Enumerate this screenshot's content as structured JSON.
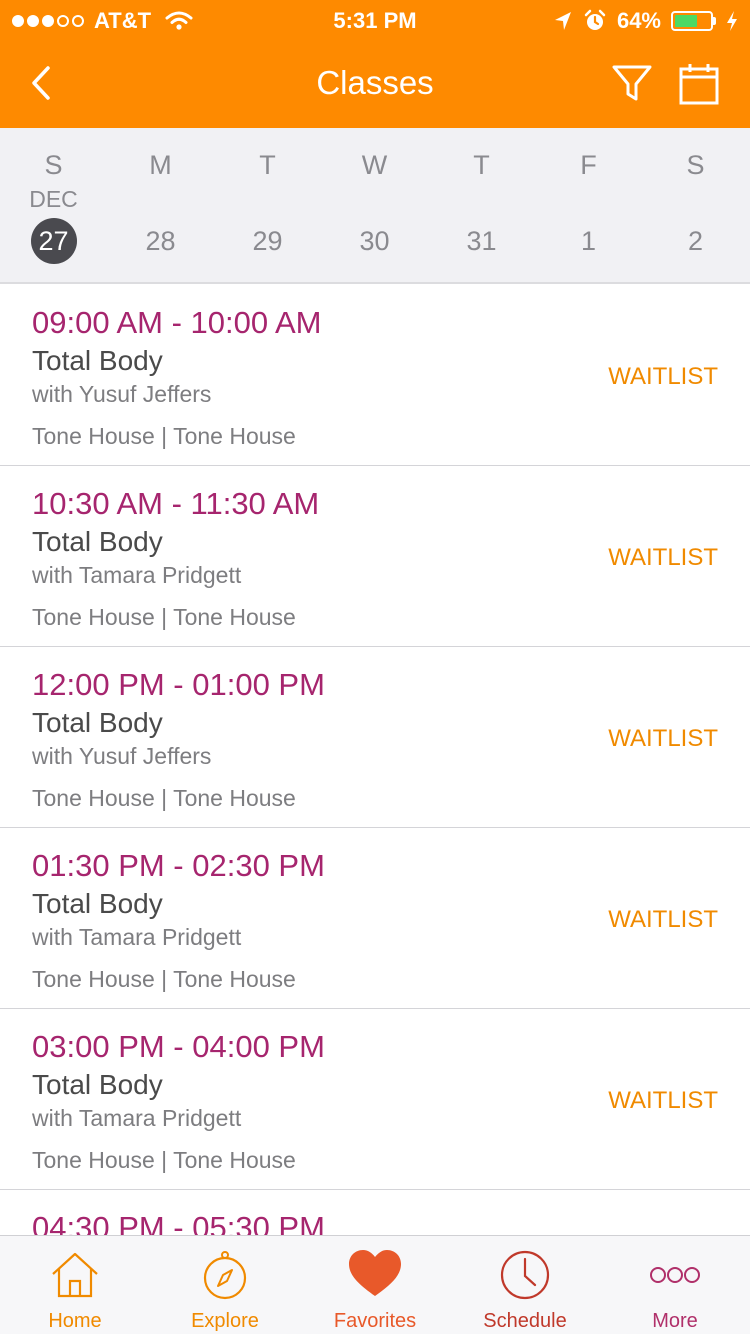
{
  "status_bar": {
    "carrier": "AT&T",
    "time": "5:31 PM",
    "battery": "64%",
    "battery_level": 0.64,
    "signal_bars_filled": 3,
    "signal_bars_total": 5
  },
  "nav": {
    "title": "Classes",
    "icons": [
      "back-icon",
      "filter-icon",
      "calendar-icon"
    ]
  },
  "colors": {
    "header_bg": "#fe8a00",
    "time_text": "#a6256e",
    "waitlist_text": "#f08a00",
    "tab_accent": "#e85a2a"
  },
  "week": {
    "month_label": "DEC",
    "days": [
      {
        "dow": "S",
        "num": "27",
        "selected": true
      },
      {
        "dow": "M",
        "num": "28",
        "selected": false
      },
      {
        "dow": "T",
        "num": "29",
        "selected": false
      },
      {
        "dow": "W",
        "num": "30",
        "selected": false
      },
      {
        "dow": "T",
        "num": "31",
        "selected": false
      },
      {
        "dow": "F",
        "num": "1",
        "selected": false
      },
      {
        "dow": "S",
        "num": "2",
        "selected": false
      }
    ]
  },
  "classes": [
    {
      "time": "09:00 AM - 10:00 AM",
      "name": "Total Body",
      "instructor": "with Yusuf Jeffers",
      "location": "Tone House | Tone House",
      "action": "WAITLIST"
    },
    {
      "time": "10:30 AM - 11:30 AM",
      "name": "Total Body",
      "instructor": "with Tamara Pridgett",
      "location": "Tone House | Tone House",
      "action": "WAITLIST"
    },
    {
      "time": "12:00 PM - 01:00 PM",
      "name": "Total Body",
      "instructor": "with Yusuf Jeffers",
      "location": "Tone House | Tone House",
      "action": "WAITLIST"
    },
    {
      "time": "01:30 PM - 02:30 PM",
      "name": "Total Body",
      "instructor": "with Tamara Pridgett",
      "location": "Tone House | Tone House",
      "action": "WAITLIST"
    },
    {
      "time": "03:00 PM - 04:00 PM",
      "name": "Total Body",
      "instructor": "with Tamara Pridgett",
      "location": "Tone House | Tone House",
      "action": "WAITLIST"
    },
    {
      "time": "04:30 PM - 05:30 PM",
      "name": "",
      "instructor": "",
      "location": "",
      "action": ""
    }
  ],
  "tabs": [
    {
      "label": "Home",
      "icon": "home-icon"
    },
    {
      "label": "Explore",
      "icon": "compass-icon"
    },
    {
      "label": "Favorites",
      "icon": "heart-icon"
    },
    {
      "label": "Schedule",
      "icon": "clock-icon"
    },
    {
      "label": "More",
      "icon": "more-icon"
    }
  ]
}
